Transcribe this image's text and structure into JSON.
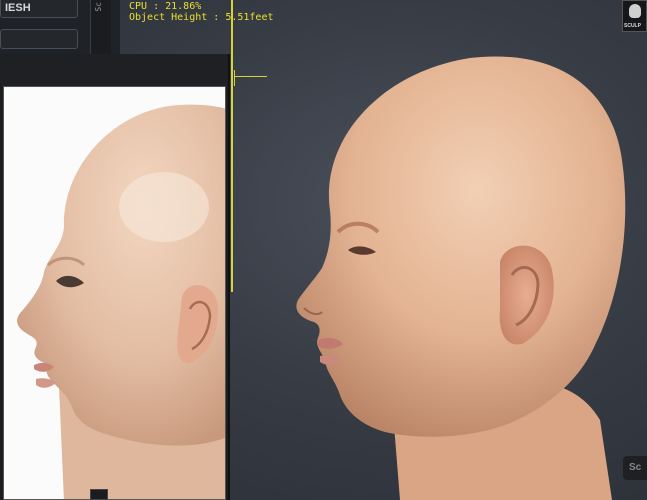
{
  "panel": {
    "mesh_button": "IESH",
    "vertical_tab": "Sc"
  },
  "stats": {
    "cpu": "CPU : 21.86%",
    "object_height": "Object Height : 5.51feet"
  },
  "logo": {
    "text": "SCULP"
  },
  "bottom_right": {
    "label": "Sc"
  },
  "colors": {
    "guide": "#d4d43a",
    "stats_text": "#e8e030",
    "viewport_bg": "#373c45",
    "skin": "#e7b99a"
  }
}
